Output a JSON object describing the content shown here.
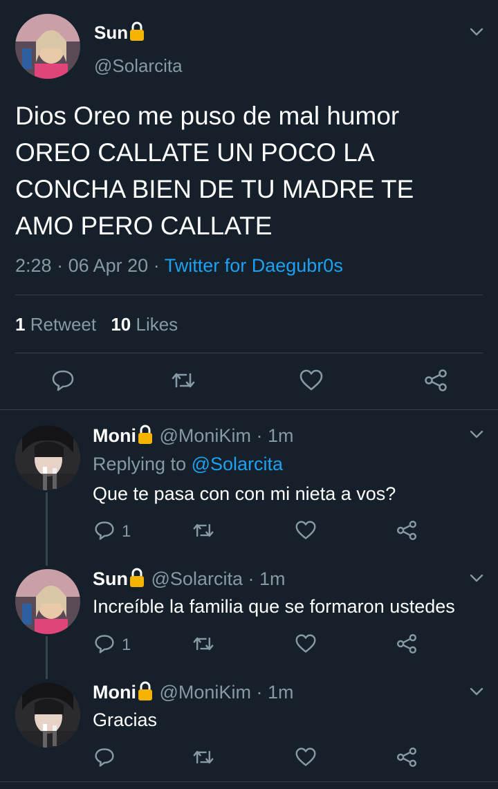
{
  "main_tweet": {
    "display_name": "Sun",
    "handle": "@Solarcita",
    "text_lines": [
      "Dios Oreo me puso de mal humor",
      "OREO CALLATE UN POCO LA",
      "CONCHA BIEN DE TU MADRE TE",
      "AMO PERO CALLATE"
    ],
    "time": "2:28",
    "date": "06 Apr 20",
    "separator": "·",
    "source": "Twitter for Daegubr0s",
    "retweets_count": "1",
    "retweets_label": "Retweet",
    "likes_count": "10",
    "likes_label": "Likes"
  },
  "replies": [
    {
      "display_name": "Moni",
      "handle": "@MoniKim",
      "time": "1m",
      "replying_prefix": "Replying to",
      "replying_handle": "@Solarcita",
      "text": "Que te pasa con con mi nieta a vos?",
      "reply_count": "1"
    },
    {
      "display_name": "Sun",
      "handle": "@Solarcita",
      "time": "1m",
      "text": "Increíble la familia que se formaron ustedes",
      "reply_count": "1"
    },
    {
      "display_name": "Moni",
      "handle": "@MoniKim",
      "time": "1m",
      "text": "Gracias",
      "reply_count": ""
    }
  ],
  "icons": {
    "lock": "lock-icon",
    "chevron": "chevron-down-icon",
    "reply": "reply-icon",
    "retweet": "retweet-icon",
    "like": "heart-icon",
    "share": "share-icon"
  },
  "colors": {
    "background": "#15202b",
    "text": "#ffffff",
    "muted": "#8899a6",
    "accent": "#1da1f2",
    "divider": "#38444d",
    "lock": "#f4b400"
  }
}
